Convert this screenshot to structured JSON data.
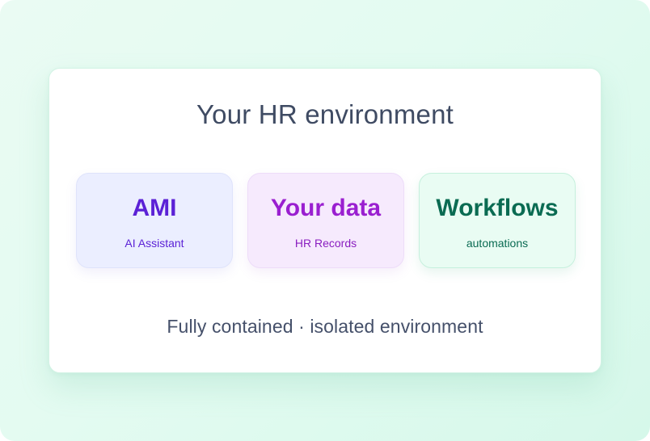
{
  "title": "Your HR environment",
  "components": [
    {
      "title": "AMI",
      "subtitle": "AI Assistant"
    },
    {
      "title": "Your data",
      "subtitle": "HR Records"
    },
    {
      "title": "Workflows",
      "subtitle": "automations"
    }
  ],
  "caption": "Fully contained · isolated environment",
  "colors": {
    "background": "#e3fbf1",
    "panel": "#ffffff",
    "ami_accent": "#5b21d6",
    "data_accent": "#9a1fd0",
    "workflows_accent": "#0a6b52",
    "text": "#3f4b63"
  }
}
